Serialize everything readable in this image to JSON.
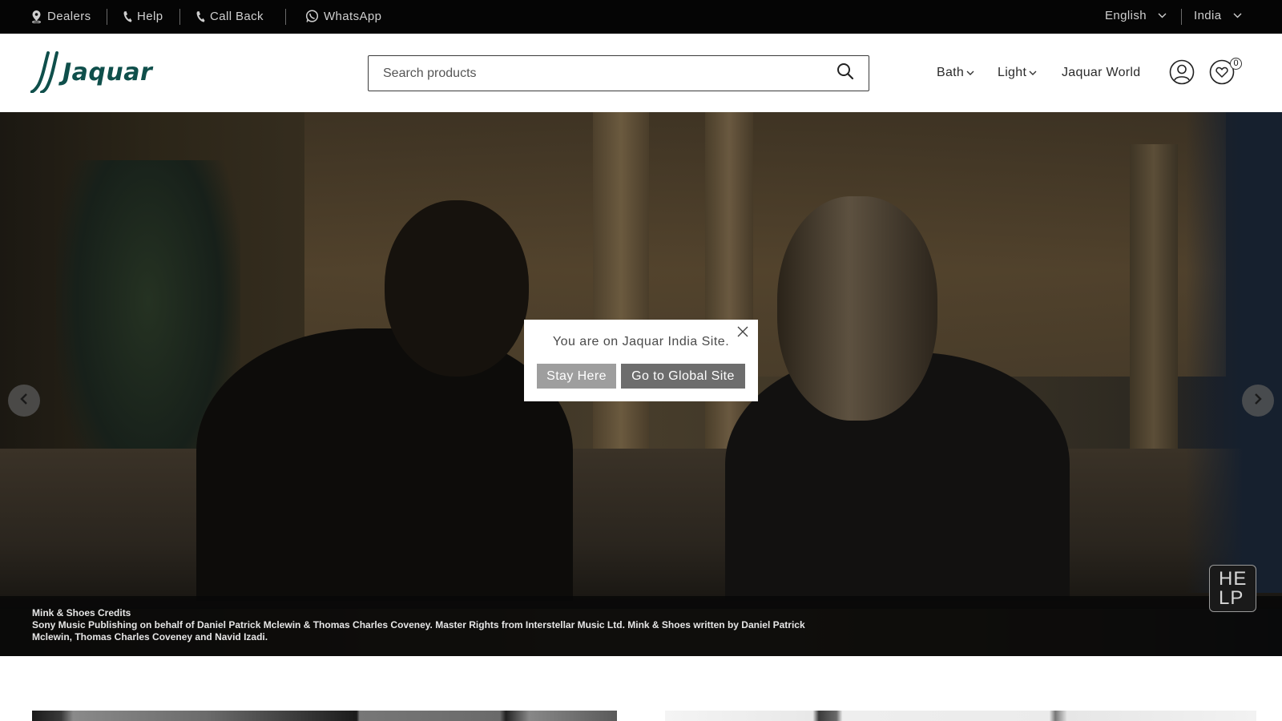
{
  "topbar": {
    "dealers": "Dealers",
    "help": "Help",
    "call_back": "Call Back",
    "whatsapp": "WhatsApp",
    "language": "English",
    "country": "India"
  },
  "header": {
    "logo_text": "Jaquar",
    "search_placeholder": "Search products",
    "nav": {
      "bath": "Bath",
      "light": "Light",
      "world": "Jaquar World"
    },
    "cart_count": "0"
  },
  "hero": {
    "caption_title": "Mink & Shoes Credits",
    "caption_body": "Sony Music Publishing on behalf of Daniel Patrick Mclewin & Thomas Charles Coveney. Master Rights from Interstellar Music Ltd. Mink & Shoes written by Daniel Patrick Mclewin, Thomas Charles Coveney and Navid Izadi.",
    "help_label_line1": "HE",
    "help_label_line2": "LP"
  },
  "modal": {
    "message": "You are on Jaquar India Site.",
    "stay_label": "Stay Here",
    "global_label": "Go to Global Site"
  },
  "colors": {
    "topbar_bg": "#050505",
    "brand": "#0f4f4b",
    "stay_btn": "#9e9e9e",
    "global_btn": "#6d6d6d"
  }
}
